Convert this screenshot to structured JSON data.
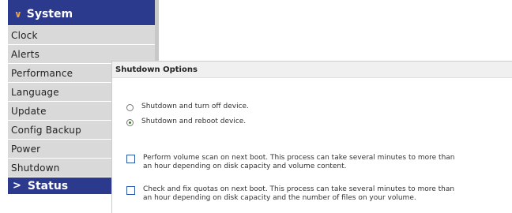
{
  "sidebar": {
    "section_label": "System",
    "items": [
      {
        "label": "Clock"
      },
      {
        "label": "Alerts"
      },
      {
        "label": "Performance"
      },
      {
        "label": "Language"
      },
      {
        "label": "Update"
      },
      {
        "label": "Config Backup"
      },
      {
        "label": "Power"
      },
      {
        "label": "Shutdown"
      }
    ],
    "status_label": "Status"
  },
  "panel": {
    "title": "Shutdown Options",
    "radios": [
      {
        "label": "Shutdown and turn off device.",
        "checked": false
      },
      {
        "label": "Shutdown and reboot device.",
        "checked": true
      }
    ],
    "checkboxes": [
      {
        "line1": "Perform volume scan on next boot. This process can take several minutes to more than",
        "line2": "an hour depending on disk capacity and volume content.",
        "checked": false
      },
      {
        "line1": "Check and fix quotas on next boot. This process can take several minutes to more than",
        "line2": "an hour depending on disk capacity and the number of files on your volume.",
        "checked": false
      }
    ]
  },
  "colors": {
    "nav_blue": "#2c3a8d",
    "item_gray": "#d9d9d9",
    "chevron_orange": "#f2a33a"
  }
}
